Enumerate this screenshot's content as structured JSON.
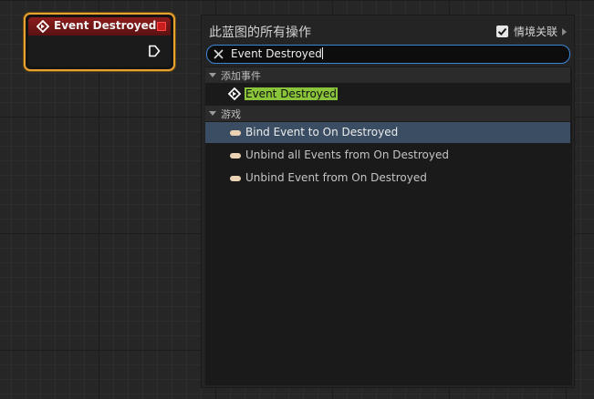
{
  "node": {
    "title": "Event Destroyed",
    "header_color": "#8c1c1c",
    "border_color": "#e8a230",
    "icons": [
      "event-icon",
      "delegate-pin-icon",
      "exec-pin-icon"
    ]
  },
  "menu": {
    "title": "此蓝图的所有操作",
    "context_sensitive_label": "情境关联",
    "context_sensitive_checked": true,
    "search": {
      "value": "Event Destroyed"
    },
    "categories": [
      {
        "label": "添加事件",
        "items": [
          {
            "label": "Event Destroyed",
            "icon": "event-icon",
            "highlighted": true,
            "selected": false
          }
        ]
      },
      {
        "label": "游戏",
        "items": [
          {
            "label": "Bind Event to On Destroyed",
            "icon": "delegate-icon",
            "highlighted": false,
            "selected": true
          },
          {
            "label": "Unbind all Events from On Destroyed",
            "icon": "delegate-icon",
            "highlighted": false,
            "selected": false
          },
          {
            "label": "Unbind Event from On Destroyed",
            "icon": "delegate-icon",
            "highlighted": false,
            "selected": false
          }
        ]
      }
    ]
  },
  "colors": {
    "search_border": "#3b86d8",
    "match_highlight": "#8ac43a",
    "selected_row": "#3b4d62",
    "delegate_pill": "#ebd2b4"
  }
}
